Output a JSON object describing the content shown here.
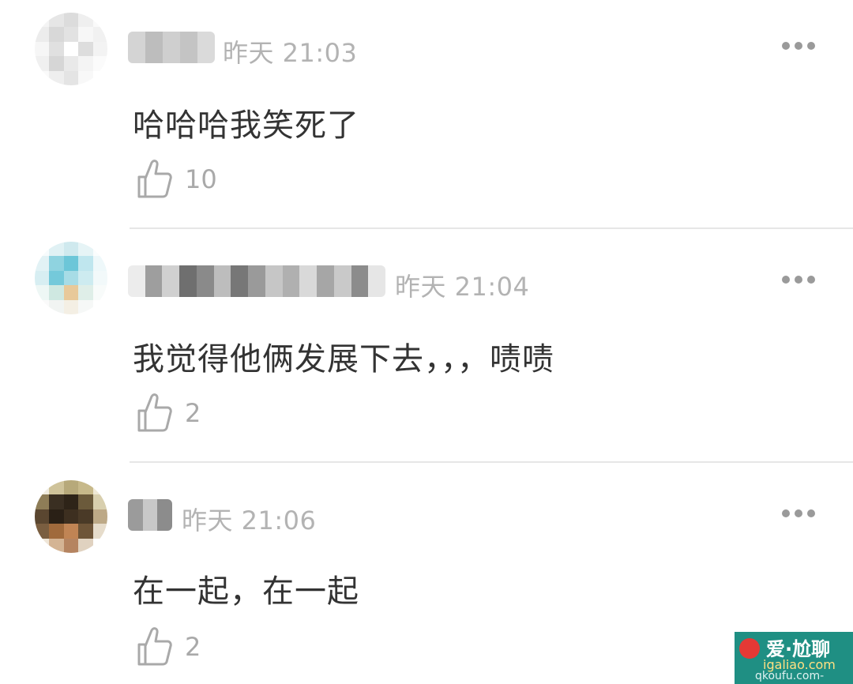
{
  "comments": [
    {
      "time": "昨天 21:03",
      "text": "哈哈哈我笑死了",
      "likes": "10",
      "avatar_icon": "blurred-avatar",
      "avatar_colors": [
        "#e8e8e8",
        "#d9d9d9",
        "#f2f2f2"
      ]
    },
    {
      "time": "昨天 21:04",
      "text": "我觉得他俩发展下去，，，啧啧",
      "likes": "2",
      "avatar_icon": "blurred-avatar",
      "avatar_colors": [
        "#bfe3ea",
        "#6cc6d8",
        "#e8c99a"
      ]
    },
    {
      "time": "昨天 21:06",
      "text": "在一起，在一起",
      "likes": "2",
      "avatar_icon": "blurred-avatar",
      "avatar_colors": [
        "#5a4630",
        "#2e2418",
        "#c7b98a"
      ]
    }
  ],
  "icons": {
    "more": "more-dots-icon",
    "like": "thumbs-up-icon"
  },
  "watermark": {
    "line1": "爱·尬聊",
    "line2": "igaliao.com",
    "line3": "qkoufu.com-"
  },
  "colors": {
    "text": "#333333",
    "meta": "#b3b3b3",
    "divider": "#e6e6e6"
  }
}
